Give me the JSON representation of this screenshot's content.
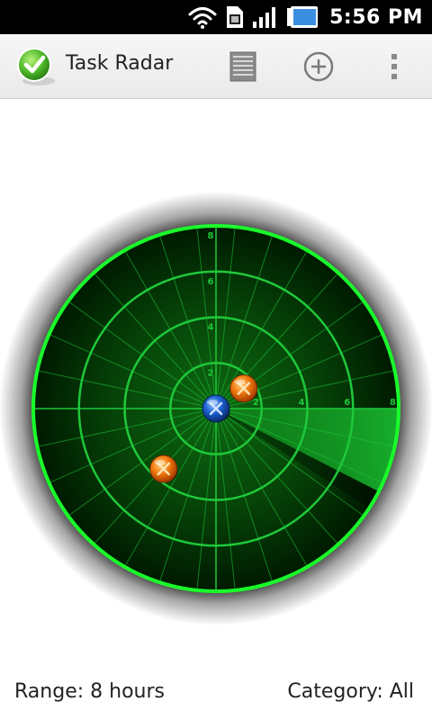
{
  "status_bar": {
    "time": "5:56 PM",
    "icons": [
      "wifi-icon",
      "sim-card-icon",
      "signal-icon",
      "battery-icon"
    ]
  },
  "action_bar": {
    "title": "Task Radar",
    "app_icon": "checkmark-icon",
    "actions": [
      {
        "name": "list-view",
        "icon": "list-icon"
      },
      {
        "name": "add-task",
        "icon": "add-circle-icon"
      },
      {
        "name": "overflow-menu",
        "icon": "more-vert-icon"
      }
    ]
  },
  "radar": {
    "range_hours": 8,
    "ring_labels": [
      "2",
      "4",
      "6",
      "8"
    ],
    "colors": {
      "ring": "#19ff2a",
      "grid": "#1fc83a",
      "background": "#000000",
      "sweep": "#1ee03a"
    },
    "tasks": [
      {
        "type": "overdue-task-marker",
        "color": "#f07a10",
        "distance_hours": 1.5,
        "bearing_deg": 54
      },
      {
        "type": "overdue-task-marker",
        "color": "#f07a10",
        "distance_hours": 3.5,
        "bearing_deg": 221
      },
      {
        "type": "current-task-marker",
        "color": "#1a5fd0",
        "distance_hours": 0,
        "bearing_deg": 0
      }
    ]
  },
  "footer": {
    "range": "Range: 8 hours",
    "category": "Category: All"
  }
}
